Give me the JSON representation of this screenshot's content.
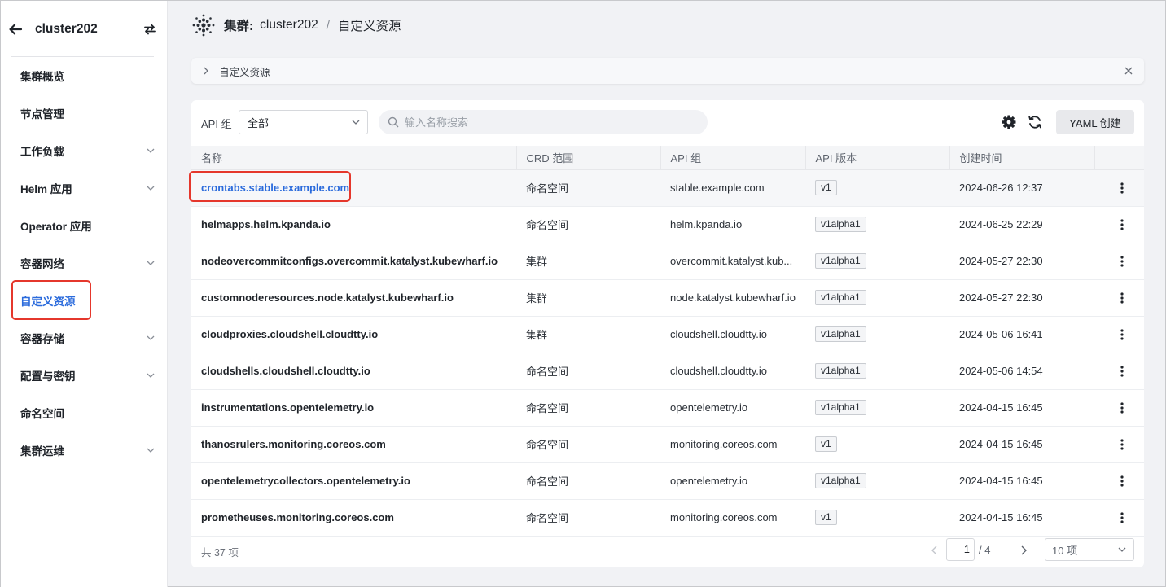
{
  "sidebar": {
    "cluster_name": "cluster202",
    "items": [
      {
        "label": "集群概览",
        "expandable": false
      },
      {
        "label": "节点管理",
        "expandable": false
      },
      {
        "label": "工作负载",
        "expandable": true
      },
      {
        "label": "Helm 应用",
        "expandable": true
      },
      {
        "label": "Operator 应用",
        "expandable": false
      },
      {
        "label": "容器网络",
        "expandable": true
      },
      {
        "label": "自定义资源",
        "expandable": false,
        "active": true
      },
      {
        "label": "容器存储",
        "expandable": true
      },
      {
        "label": "配置与密钥",
        "expandable": true
      },
      {
        "label": "命名空间",
        "expandable": false
      },
      {
        "label": "集群运维",
        "expandable": true
      }
    ]
  },
  "breadcrumb": {
    "label": "集群:",
    "cluster": "cluster202",
    "separator": "/",
    "current": "自定义资源"
  },
  "notice": {
    "text": "自定义资源"
  },
  "toolbar": {
    "api_group_label": "API 组",
    "api_group_value": "全部",
    "search_placeholder": "输入名称搜索",
    "yaml_create_label": "YAML 创建"
  },
  "table": {
    "columns": [
      "名称",
      "CRD 范围",
      "API 组",
      "API 版本",
      "创建时间",
      ""
    ],
    "rows": [
      {
        "name": "crontabs.stable.example.com",
        "scope": "命名空间",
        "group": "stable.example.com",
        "version": "v1",
        "created": "2024-06-26 12:37"
      },
      {
        "name": "helmapps.helm.kpanda.io",
        "scope": "命名空间",
        "group": "helm.kpanda.io",
        "version": "v1alpha1",
        "created": "2024-06-25 22:29"
      },
      {
        "name": "nodeovercommitconfigs.overcommit.katalyst.kubewharf.io",
        "scope": "集群",
        "group": "overcommit.katalyst.kub...",
        "version": "v1alpha1",
        "created": "2024-05-27 22:30"
      },
      {
        "name": "customnoderesources.node.katalyst.kubewharf.io",
        "scope": "集群",
        "group": "node.katalyst.kubewharf.io",
        "version": "v1alpha1",
        "created": "2024-05-27 22:30"
      },
      {
        "name": "cloudproxies.cloudshell.cloudtty.io",
        "scope": "集群",
        "group": "cloudshell.cloudtty.io",
        "version": "v1alpha1",
        "created": "2024-05-06 16:41"
      },
      {
        "name": "cloudshells.cloudshell.cloudtty.io",
        "scope": "命名空间",
        "group": "cloudshell.cloudtty.io",
        "version": "v1alpha1",
        "created": "2024-05-06 14:54"
      },
      {
        "name": "instrumentations.opentelemetry.io",
        "scope": "命名空间",
        "group": "opentelemetry.io",
        "version": "v1alpha1",
        "created": "2024-04-15 16:45"
      },
      {
        "name": "thanosrulers.monitoring.coreos.com",
        "scope": "命名空间",
        "group": "monitoring.coreos.com",
        "version": "v1",
        "created": "2024-04-15 16:45"
      },
      {
        "name": "opentelemetrycollectors.opentelemetry.io",
        "scope": "命名空间",
        "group": "opentelemetry.io",
        "version": "v1alpha1",
        "created": "2024-04-15 16:45"
      },
      {
        "name": "prometheuses.monitoring.coreos.com",
        "scope": "命名空间",
        "group": "monitoring.coreos.com",
        "version": "v1",
        "created": "2024-04-15 16:45"
      }
    ]
  },
  "pagination": {
    "total_text": "共 37 项",
    "current_page": "1",
    "total_pages": "/ 4",
    "page_size": "10 项"
  },
  "colors": {
    "accent": "#2b6bdc",
    "highlight": "#e5372c"
  }
}
